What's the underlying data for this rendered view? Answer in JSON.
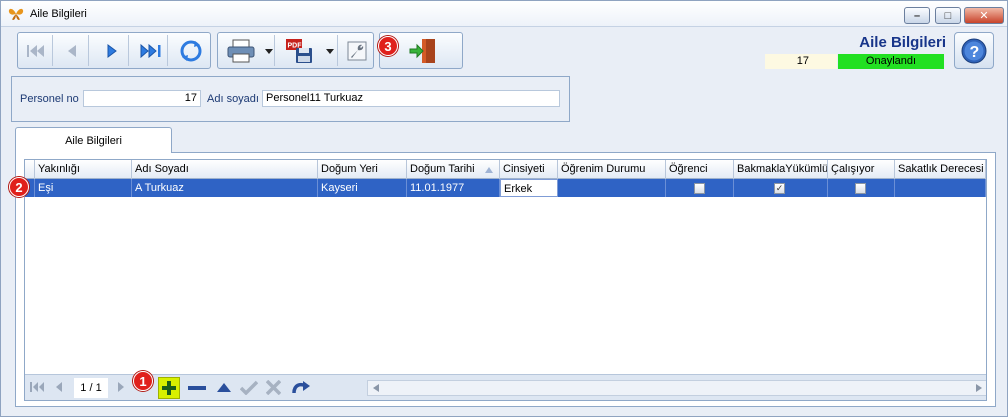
{
  "window": {
    "title": "Aile Bilgileri",
    "controls": {
      "minimize": "–",
      "maximize": "□",
      "close": "✕"
    }
  },
  "toolbar": {
    "nav_icons": [
      "first-record-icon",
      "previous-record-icon",
      "next-record-icon",
      "last-record-icon",
      "refresh-icon"
    ],
    "print_icon": "printer-icon",
    "pdf_label": "PDF",
    "tools_icon": "wrench-icon",
    "exit_icon": "exit-door-icon"
  },
  "header": {
    "form_title": "Aile Bilgileri",
    "record_no": "17",
    "status": "Onaylandı",
    "status_color": "#22e022",
    "help_icon": "help-icon"
  },
  "personnel": {
    "no_label": "Personel no",
    "no_value": "17",
    "name_label": "Adı soyadı",
    "name_value": "Personel11 Turkuaz"
  },
  "tab": {
    "label": "Aile Bilgileri"
  },
  "grid": {
    "columns": [
      "Yakınlığı",
      "Adı Soyadı",
      "Doğum Yeri",
      "Doğum Tarihi",
      "Cinsiyeti",
      "Öğrenim Durumu",
      "Öğrenci",
      "BakmaklaYükümlü",
      "Çalışıyor",
      "Sakatlık Derecesi"
    ],
    "sort_column": "Doğum Tarihi",
    "rows": [
      {
        "yakinligi": "Eşi",
        "adi_soyadi": "A Turkuaz",
        "dogum_yeri": "Kayseri",
        "dogum_tarihi": "11.01.1977",
        "cinsiyeti": "Erkek",
        "ogrenim_durumu": "",
        "ogrenci": false,
        "bakmakla_yukumlu": true,
        "calisiyor": false,
        "sakatlik_derecesi": ""
      }
    ],
    "selection_color": "#2f63c5"
  },
  "navigator": {
    "page": "1 / 1",
    "icons": [
      "first-page-icon",
      "prev-page-icon",
      "next-page-icon",
      "add-icon",
      "remove-icon",
      "move-up-icon",
      "confirm-icon",
      "cancel-icon",
      "redo-icon"
    ]
  },
  "badges": [
    "1",
    "2",
    "3"
  ]
}
